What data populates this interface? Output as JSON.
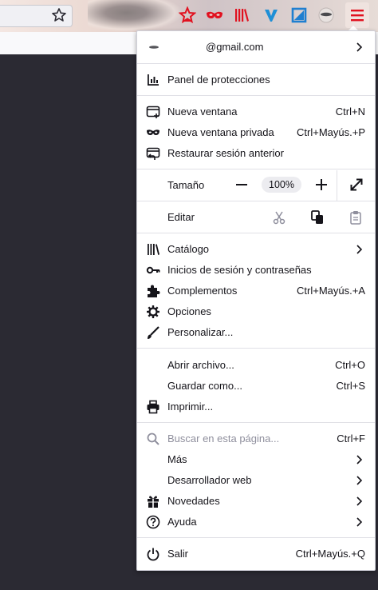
{
  "account": {
    "email": "@gmail.com"
  },
  "menu": {
    "protections": "Panel de protecciones",
    "new_window": {
      "label": "Nueva ventana",
      "shortcut": "Ctrl+N"
    },
    "new_private": {
      "label": "Nueva ventana privada",
      "shortcut": "Ctrl+Mayús.+P"
    },
    "restore": {
      "label": "Restaurar sesión anterior"
    },
    "zoom": {
      "label": "Tamaño",
      "value": "100%"
    },
    "edit": {
      "label": "Editar"
    },
    "library": {
      "label": "Catálogo"
    },
    "logins": {
      "label": "Inicios de sesión y contraseñas"
    },
    "addons": {
      "label": "Complementos",
      "shortcut": "Ctrl+Mayús.+A"
    },
    "options": {
      "label": "Opciones"
    },
    "customize": {
      "label": "Personalizar..."
    },
    "open_file": {
      "label": "Abrir archivo...",
      "shortcut": "Ctrl+O"
    },
    "save_as": {
      "label": "Guardar como...",
      "shortcut": "Ctrl+S"
    },
    "print": {
      "label": "Imprimir..."
    },
    "find": {
      "label": "Buscar en esta página...",
      "shortcut": "Ctrl+F"
    },
    "more": {
      "label": "Más"
    },
    "webdev": {
      "label": "Desarrollador web"
    },
    "whatsnew": {
      "label": "Novedades"
    },
    "help": {
      "label": "Ayuda"
    },
    "quit": {
      "label": "Salir",
      "shortcut": "Ctrl+Mayús.+Q"
    }
  },
  "colors": {
    "accent_red": "#e1111f",
    "menu_bg": "#ffffff",
    "page_bg": "#2b2a33"
  }
}
